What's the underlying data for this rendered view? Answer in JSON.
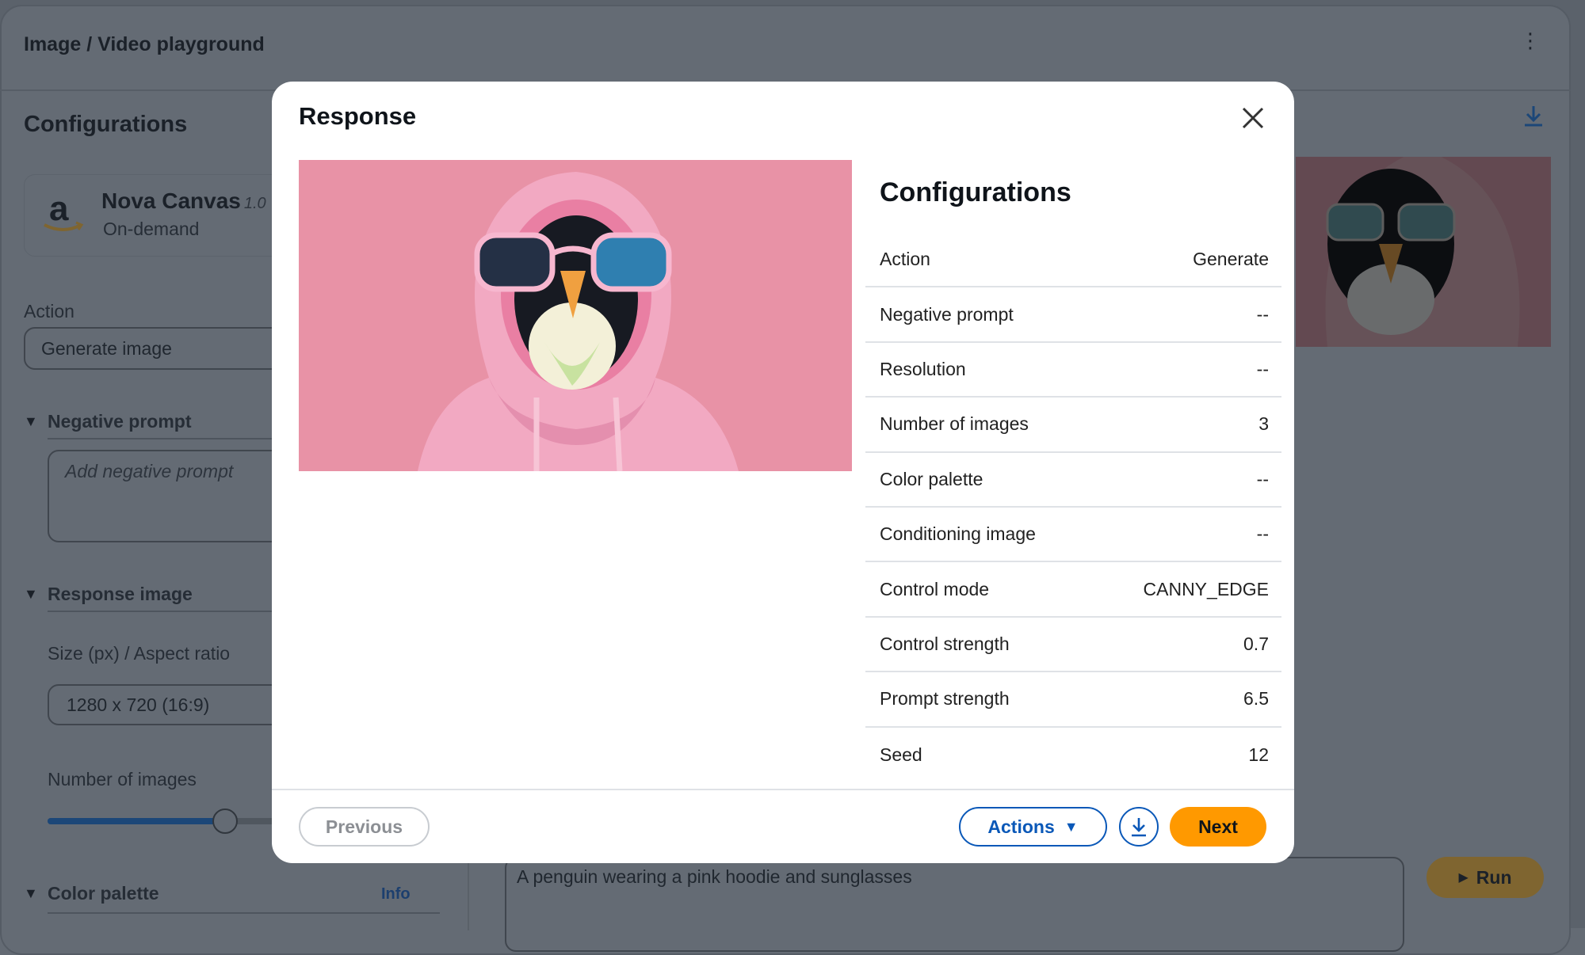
{
  "header": {
    "title": "Image / Video playground",
    "menu_icon": "kebab-icon"
  },
  "left_panel": {
    "title": "Configurations",
    "model": {
      "name": "Nova Canvas",
      "version": "1.0",
      "type": "On-demand"
    },
    "action": {
      "label": "Action",
      "value": "Generate image"
    },
    "negative_prompt": {
      "label": "Negative prompt",
      "placeholder": "Add negative prompt"
    },
    "response_image": {
      "label": "Response image",
      "size_label": "Size (px) / Aspect ratio",
      "size_value": "1280 x 720 (16:9)",
      "num_images_label": "Number of images",
      "num_images_value": 3,
      "num_images_fraction": 0.43
    },
    "color_palette": {
      "label": "Color palette",
      "info": "Info"
    }
  },
  "main": {
    "prompt": "A penguin wearing a pink hoodie and sunglasses",
    "run_label": "Run"
  },
  "modal": {
    "title": "Response",
    "config_title": "Configurations",
    "rows": [
      {
        "label": "Action",
        "value": "Generate"
      },
      {
        "label": "Negative prompt",
        "value": "--"
      },
      {
        "label": "Resolution",
        "value": "--"
      },
      {
        "label": "Number of images",
        "value": "3"
      },
      {
        "label": "Color palette",
        "value": "--"
      },
      {
        "label": "Conditioning image",
        "value": "--"
      },
      {
        "label": "Control mode",
        "value": "CANNY_EDGE"
      },
      {
        "label": "Control strength",
        "value": "0.7"
      },
      {
        "label": "Prompt strength",
        "value": "6.5"
      },
      {
        "label": "Seed",
        "value": "12"
      }
    ],
    "previous_label": "Previous",
    "actions_label": "Actions",
    "next_label": "Next"
  },
  "colors": {
    "primary": "#0a58b8",
    "accent": "#ff9900",
    "image_bg": "#e892a6"
  }
}
